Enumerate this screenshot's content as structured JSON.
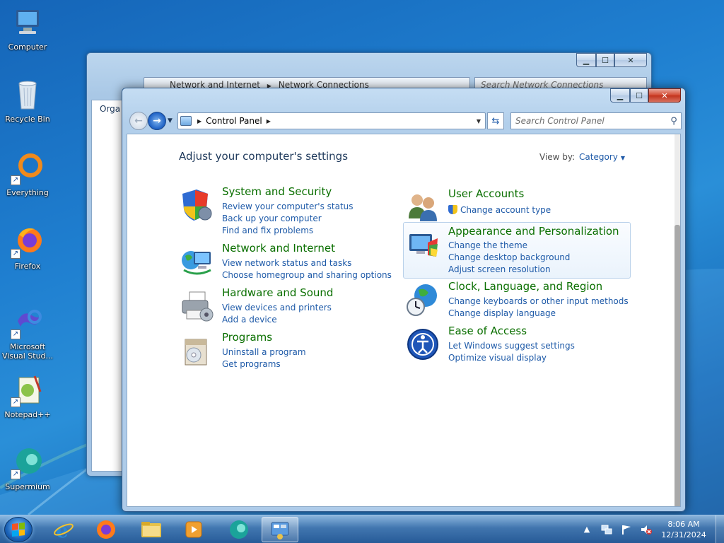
{
  "desktop": {
    "icons": [
      {
        "label": "Computer"
      },
      {
        "label": "Recycle Bin"
      },
      {
        "label": "Everything"
      },
      {
        "label": "Firefox"
      },
      {
        "label": "Microsoft Visual Stud..."
      },
      {
        "label": "Notepad++"
      },
      {
        "label": "Supermium"
      }
    ]
  },
  "back_window": {
    "breadcrumb": [
      "Network and Internet",
      "Network Connections"
    ],
    "search_placeholder": "Search Network Connections",
    "toolbar_first": "Orga"
  },
  "window": {
    "breadcrumb": "Control Panel",
    "search_placeholder": "Search Control Panel",
    "heading": "Adjust your computer's settings",
    "view_by_label": "View by:",
    "view_by_value": "Category",
    "categories": [
      {
        "title": "System and Security",
        "links": [
          "Review your computer's status",
          "Back up your computer",
          "Find and fix problems"
        ]
      },
      {
        "title": "Network and Internet",
        "links": [
          "View network status and tasks",
          "Choose homegroup and sharing options"
        ]
      },
      {
        "title": "Hardware and Sound",
        "links": [
          "View devices and printers",
          "Add a device"
        ]
      },
      {
        "title": "Programs",
        "links": [
          "Uninstall a program",
          "Get programs"
        ]
      },
      {
        "title": "User Accounts",
        "links": [
          "Change account type"
        ]
      },
      {
        "title": "Appearance and Personalization",
        "links": [
          "Change the theme",
          "Change desktop background",
          "Adjust screen resolution"
        ]
      },
      {
        "title": "Clock, Language, and Region",
        "links": [
          "Change keyboards or other input methods",
          "Change display language"
        ]
      },
      {
        "title": "Ease of Access",
        "links": [
          "Let Windows suggest settings",
          "Optimize visual display"
        ]
      }
    ]
  },
  "taskbar": {
    "apps": [
      "Internet Explorer",
      "Firefox",
      "Windows Explorer",
      "Media Player",
      "Supermium",
      "Control Panel"
    ],
    "time": "8:06 AM",
    "date": "12/31/2024"
  },
  "colors": {
    "category_title": "#0a6f00",
    "link": "#1e5aa8",
    "heading": "#1e395b"
  }
}
